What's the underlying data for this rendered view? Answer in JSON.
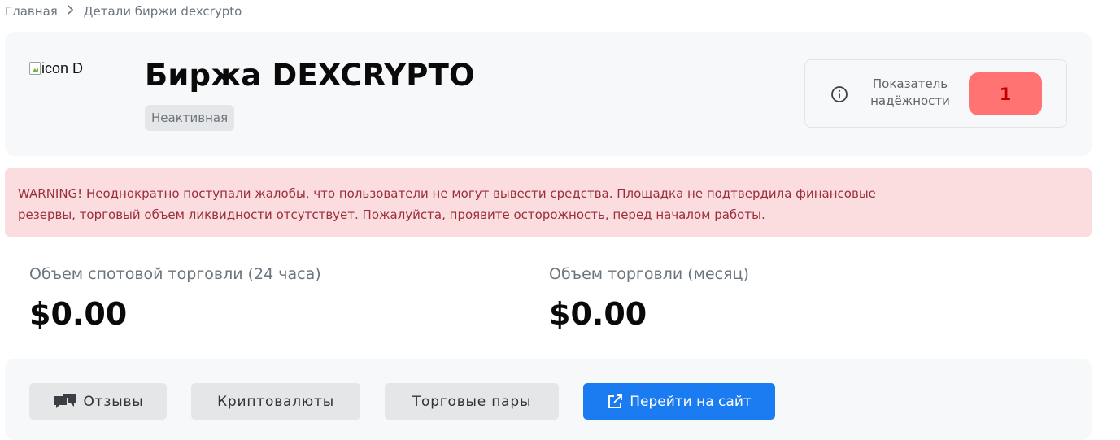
{
  "breadcrumb": {
    "home": "Главная",
    "current": "Детали биржи dexcrypto"
  },
  "exchange": {
    "logo_alt": "icon D",
    "title": "Биржа DEXCRYPTO",
    "status": "Неактивная"
  },
  "reliability": {
    "label_line1": "Показатель",
    "label_line2": "надёжности",
    "value": "1",
    "value_color": "#ff7373"
  },
  "warning": {
    "line1": "WARNING! Неоднократно поступали жалобы, что пользователи не могут вывести средства. Площадка не подтвердила финансовые",
    "line2": "резервы, торговый объем ликвидности отсутствует. Пожалуйста, проявите осторожность, перед началом работы."
  },
  "stats": {
    "spot_label": "Объем спотовой торговли (24 часа)",
    "spot_value": "$0.00",
    "month_label": "Объем торговли (месяц)",
    "month_value": "$0.00"
  },
  "actions": {
    "reviews": "Отзывы",
    "cryptocurrencies": "Криптовалюты",
    "trading_pairs": "Торговые пары",
    "visit_site": "Перейти на сайт"
  },
  "icons": {
    "breadcrumb_separator": "chevron-right-icon",
    "info": "info-icon",
    "reviews": "chat-bubbles-icon",
    "visit_site": "external-link-icon"
  },
  "colors": {
    "primary": "#1a7cf0",
    "warning_bg": "#fbdde0",
    "warning_text": "#9a2f3a",
    "card_bg": "#f7f8fa"
  }
}
